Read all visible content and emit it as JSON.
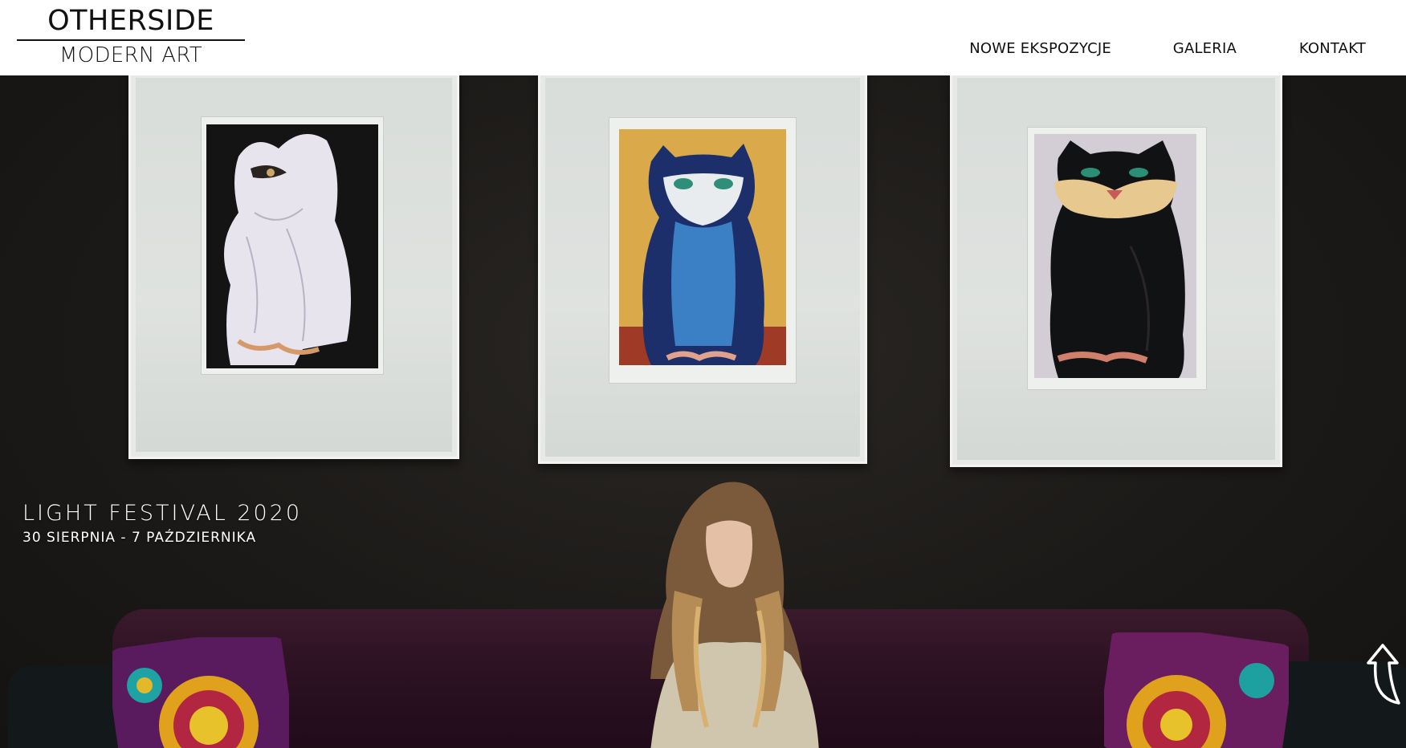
{
  "header": {
    "logo_top": "OTHERSIDE",
    "logo_bottom": "MODERN ART",
    "nav": [
      {
        "label": "NOWE EKSPOZYCJE"
      },
      {
        "label": "GALERIA"
      },
      {
        "label": "KONTAKT"
      }
    ]
  },
  "hero": {
    "title": "LIGHT FESTIVAL 2020",
    "dates": "30 SIERPNIA - 7 PAŹDZIERNIKA"
  },
  "icons": {
    "scroll_top": "arrow-up-icon"
  },
  "colors": {
    "header_bg": "#ffffff",
    "hero_text": "#ffffff",
    "wall": "#1c1a18",
    "sofa": "#2b1121"
  }
}
